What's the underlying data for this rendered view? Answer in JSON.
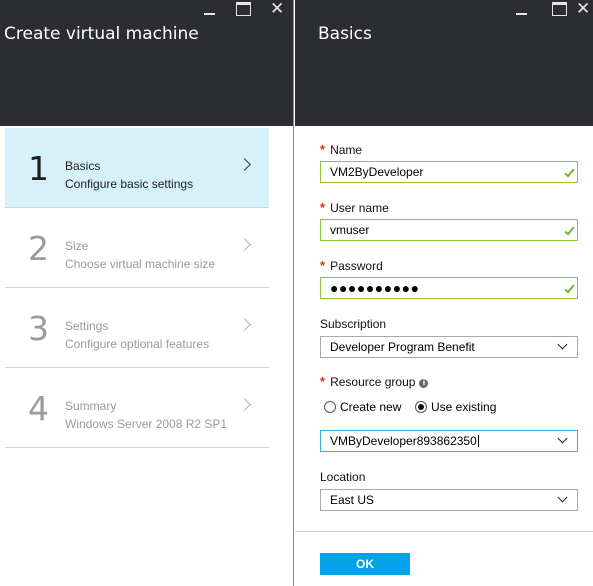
{
  "left_blade": {
    "title": "Create virtual machine",
    "steps": [
      {
        "number": "1",
        "title": "Basics",
        "subtitle": "Configure basic settings",
        "active": true
      },
      {
        "number": "2",
        "title": "Size",
        "subtitle": "Choose virtual machine size",
        "active": false
      },
      {
        "number": "3",
        "title": "Settings",
        "subtitle": "Configure optional features",
        "active": false
      },
      {
        "number": "4",
        "title": "Summary",
        "subtitle": "Windows Server 2008 R2 SP1",
        "active": false
      }
    ]
  },
  "right_blade": {
    "title": "Basics",
    "name": {
      "label": "Name",
      "value": "VM2ByDeveloper"
    },
    "username": {
      "label": "User name",
      "value": "vmuser"
    },
    "password": {
      "label": "Password",
      "value": "●●●●●●●●●●"
    },
    "subscription": {
      "label": "Subscription",
      "value": "Developer Program Benefit"
    },
    "resource_group": {
      "label": "Resource group",
      "option_new": "Create new",
      "option_existing": "Use existing",
      "selected_option": "Use existing",
      "value": "VMByDeveloper893862350"
    },
    "location": {
      "label": "Location",
      "value": "East US"
    },
    "ok_label": "OK"
  },
  "window_controls": {
    "minimize": "minimize-icon",
    "maximize": "maximize-icon",
    "close": "✕"
  },
  "colors": {
    "header_bg": "#2b2d30",
    "active_step_bg": "#d7f1fb",
    "valid_border": "#8dc63f",
    "required_asterisk": "#e0301e",
    "ok_button": "#00a2e8",
    "focus_border": "#3ea8e0"
  }
}
